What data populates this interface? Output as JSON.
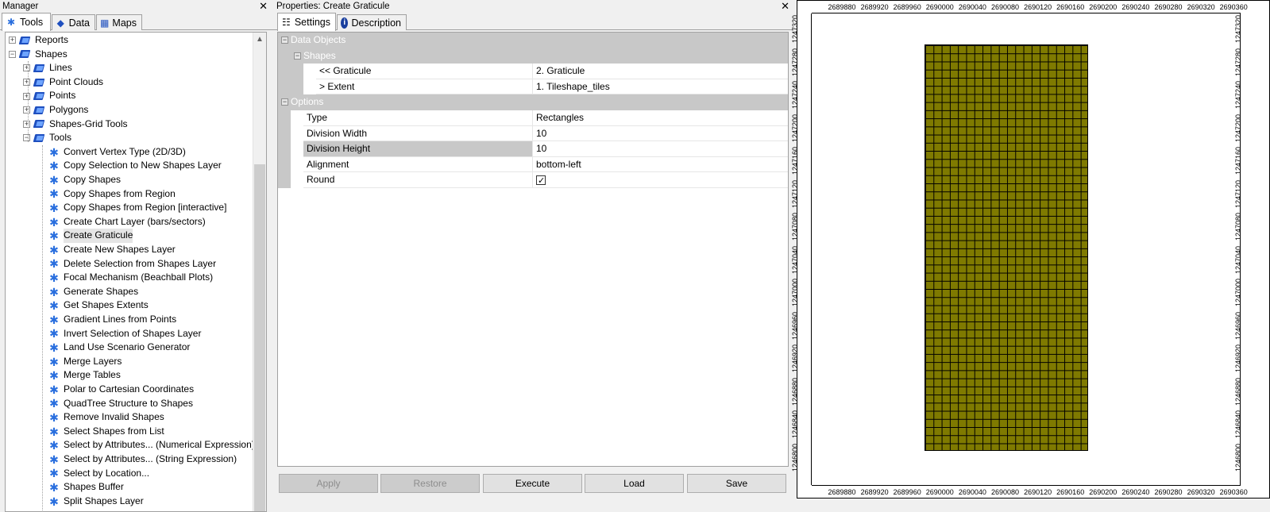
{
  "manager": {
    "title": "Manager",
    "tabs": [
      {
        "label": "Tools",
        "icon": "tools-icon"
      },
      {
        "label": "Data",
        "icon": "data-icon"
      },
      {
        "label": "Maps",
        "icon": "maps-icon"
      }
    ],
    "tree": [
      {
        "label": "Reports",
        "level": 0,
        "type": "book",
        "expander": "+"
      },
      {
        "label": "Shapes",
        "level": 0,
        "type": "book",
        "expander": "-"
      },
      {
        "label": "Lines",
        "level": 1,
        "type": "book",
        "expander": "+"
      },
      {
        "label": "Point Clouds",
        "level": 1,
        "type": "book",
        "expander": "+"
      },
      {
        "label": "Points",
        "level": 1,
        "type": "book",
        "expander": "+"
      },
      {
        "label": "Polygons",
        "level": 1,
        "type": "book",
        "expander": "+"
      },
      {
        "label": "Shapes-Grid Tools",
        "level": 1,
        "type": "book",
        "expander": "+"
      },
      {
        "label": "Tools",
        "level": 1,
        "type": "book",
        "expander": "-"
      },
      {
        "label": "Convert Vertex Type (2D/3D)",
        "level": 2,
        "type": "tool"
      },
      {
        "label": "Copy Selection to New Shapes Layer",
        "level": 2,
        "type": "tool"
      },
      {
        "label": "Copy Shapes",
        "level": 2,
        "type": "tool"
      },
      {
        "label": "Copy Shapes from Region",
        "level": 2,
        "type": "tool"
      },
      {
        "label": "Copy Shapes from Region [interactive]",
        "level": 2,
        "type": "tool"
      },
      {
        "label": "Create Chart Layer (bars/sectors)",
        "level": 2,
        "type": "tool"
      },
      {
        "label": "Create Graticule",
        "level": 2,
        "type": "tool",
        "selected": true
      },
      {
        "label": "Create New Shapes Layer",
        "level": 2,
        "type": "tool"
      },
      {
        "label": "Delete Selection from Shapes Layer",
        "level": 2,
        "type": "tool"
      },
      {
        "label": "Focal Mechanism (Beachball Plots)",
        "level": 2,
        "type": "tool"
      },
      {
        "label": "Generate Shapes",
        "level": 2,
        "type": "tool"
      },
      {
        "label": "Get Shapes Extents",
        "level": 2,
        "type": "tool"
      },
      {
        "label": "Gradient Lines from Points",
        "level": 2,
        "type": "tool"
      },
      {
        "label": "Invert Selection of Shapes Layer",
        "level": 2,
        "type": "tool"
      },
      {
        "label": "Land Use Scenario Generator",
        "level": 2,
        "type": "tool"
      },
      {
        "label": "Merge Layers",
        "level": 2,
        "type": "tool"
      },
      {
        "label": "Merge Tables",
        "level": 2,
        "type": "tool"
      },
      {
        "label": "Polar to Cartesian Coordinates",
        "level": 2,
        "type": "tool"
      },
      {
        "label": "QuadTree Structure to Shapes",
        "level": 2,
        "type": "tool"
      },
      {
        "label": "Remove Invalid Shapes",
        "level": 2,
        "type": "tool"
      },
      {
        "label": "Select Shapes from List",
        "level": 2,
        "type": "tool"
      },
      {
        "label": "Select by Attributes... (Numerical Expression)",
        "level": 2,
        "type": "tool"
      },
      {
        "label": "Select by Attributes... (String Expression)",
        "level": 2,
        "type": "tool"
      },
      {
        "label": "Select by Location...",
        "level": 2,
        "type": "tool"
      },
      {
        "label": "Shapes Buffer",
        "level": 2,
        "type": "tool"
      },
      {
        "label": "Split Shapes Layer",
        "level": 2,
        "type": "tool"
      }
    ]
  },
  "properties": {
    "title": "Properties: Create Graticule",
    "tabs": [
      {
        "label": "Settings",
        "icon": "settings-icon"
      },
      {
        "label": "Description",
        "icon": "info-icon"
      }
    ],
    "grid": [
      {
        "kind": "cat",
        "indent": 0,
        "name": "Data Objects"
      },
      {
        "kind": "cat",
        "indent": 1,
        "name": "Shapes"
      },
      {
        "kind": "row",
        "indent": 2,
        "name": "<< Graticule",
        "value": "2. Graticule"
      },
      {
        "kind": "row",
        "indent": 2,
        "name": "> Extent",
        "value": "1. Tileshape_tiles"
      },
      {
        "kind": "cat",
        "indent": 0,
        "name": "Options"
      },
      {
        "kind": "row",
        "indent": 1,
        "name": "Type",
        "value": "Rectangles"
      },
      {
        "kind": "row",
        "indent": 1,
        "name": "Division Width",
        "value": "10"
      },
      {
        "kind": "row",
        "indent": 1,
        "name": "Division Height",
        "value": "10",
        "highlight": true
      },
      {
        "kind": "row",
        "indent": 1,
        "name": "Alignment",
        "value": "bottom-left"
      },
      {
        "kind": "check",
        "indent": 1,
        "name": "Round",
        "checked": true
      }
    ],
    "buttons": {
      "apply": "Apply",
      "restore": "Restore",
      "execute": "Execute",
      "load": "Load",
      "save": "Save"
    }
  },
  "map": {
    "x_ticks": [
      "2689880",
      "2689920",
      "2689960",
      "2690000",
      "2690040",
      "2690080",
      "2690120",
      "2690160",
      "2690200",
      "2690240",
      "2690280",
      "2690320",
      "2690360"
    ],
    "y_ticks": [
      "1247320",
      "1247280",
      "1247240",
      "1247200",
      "1247160",
      "1247120",
      "1247080",
      "1247040",
      "1247000",
      "1246960",
      "1246920",
      "1246880",
      "1246840",
      "1246800"
    ],
    "fill_color": "#7f7a00"
  }
}
